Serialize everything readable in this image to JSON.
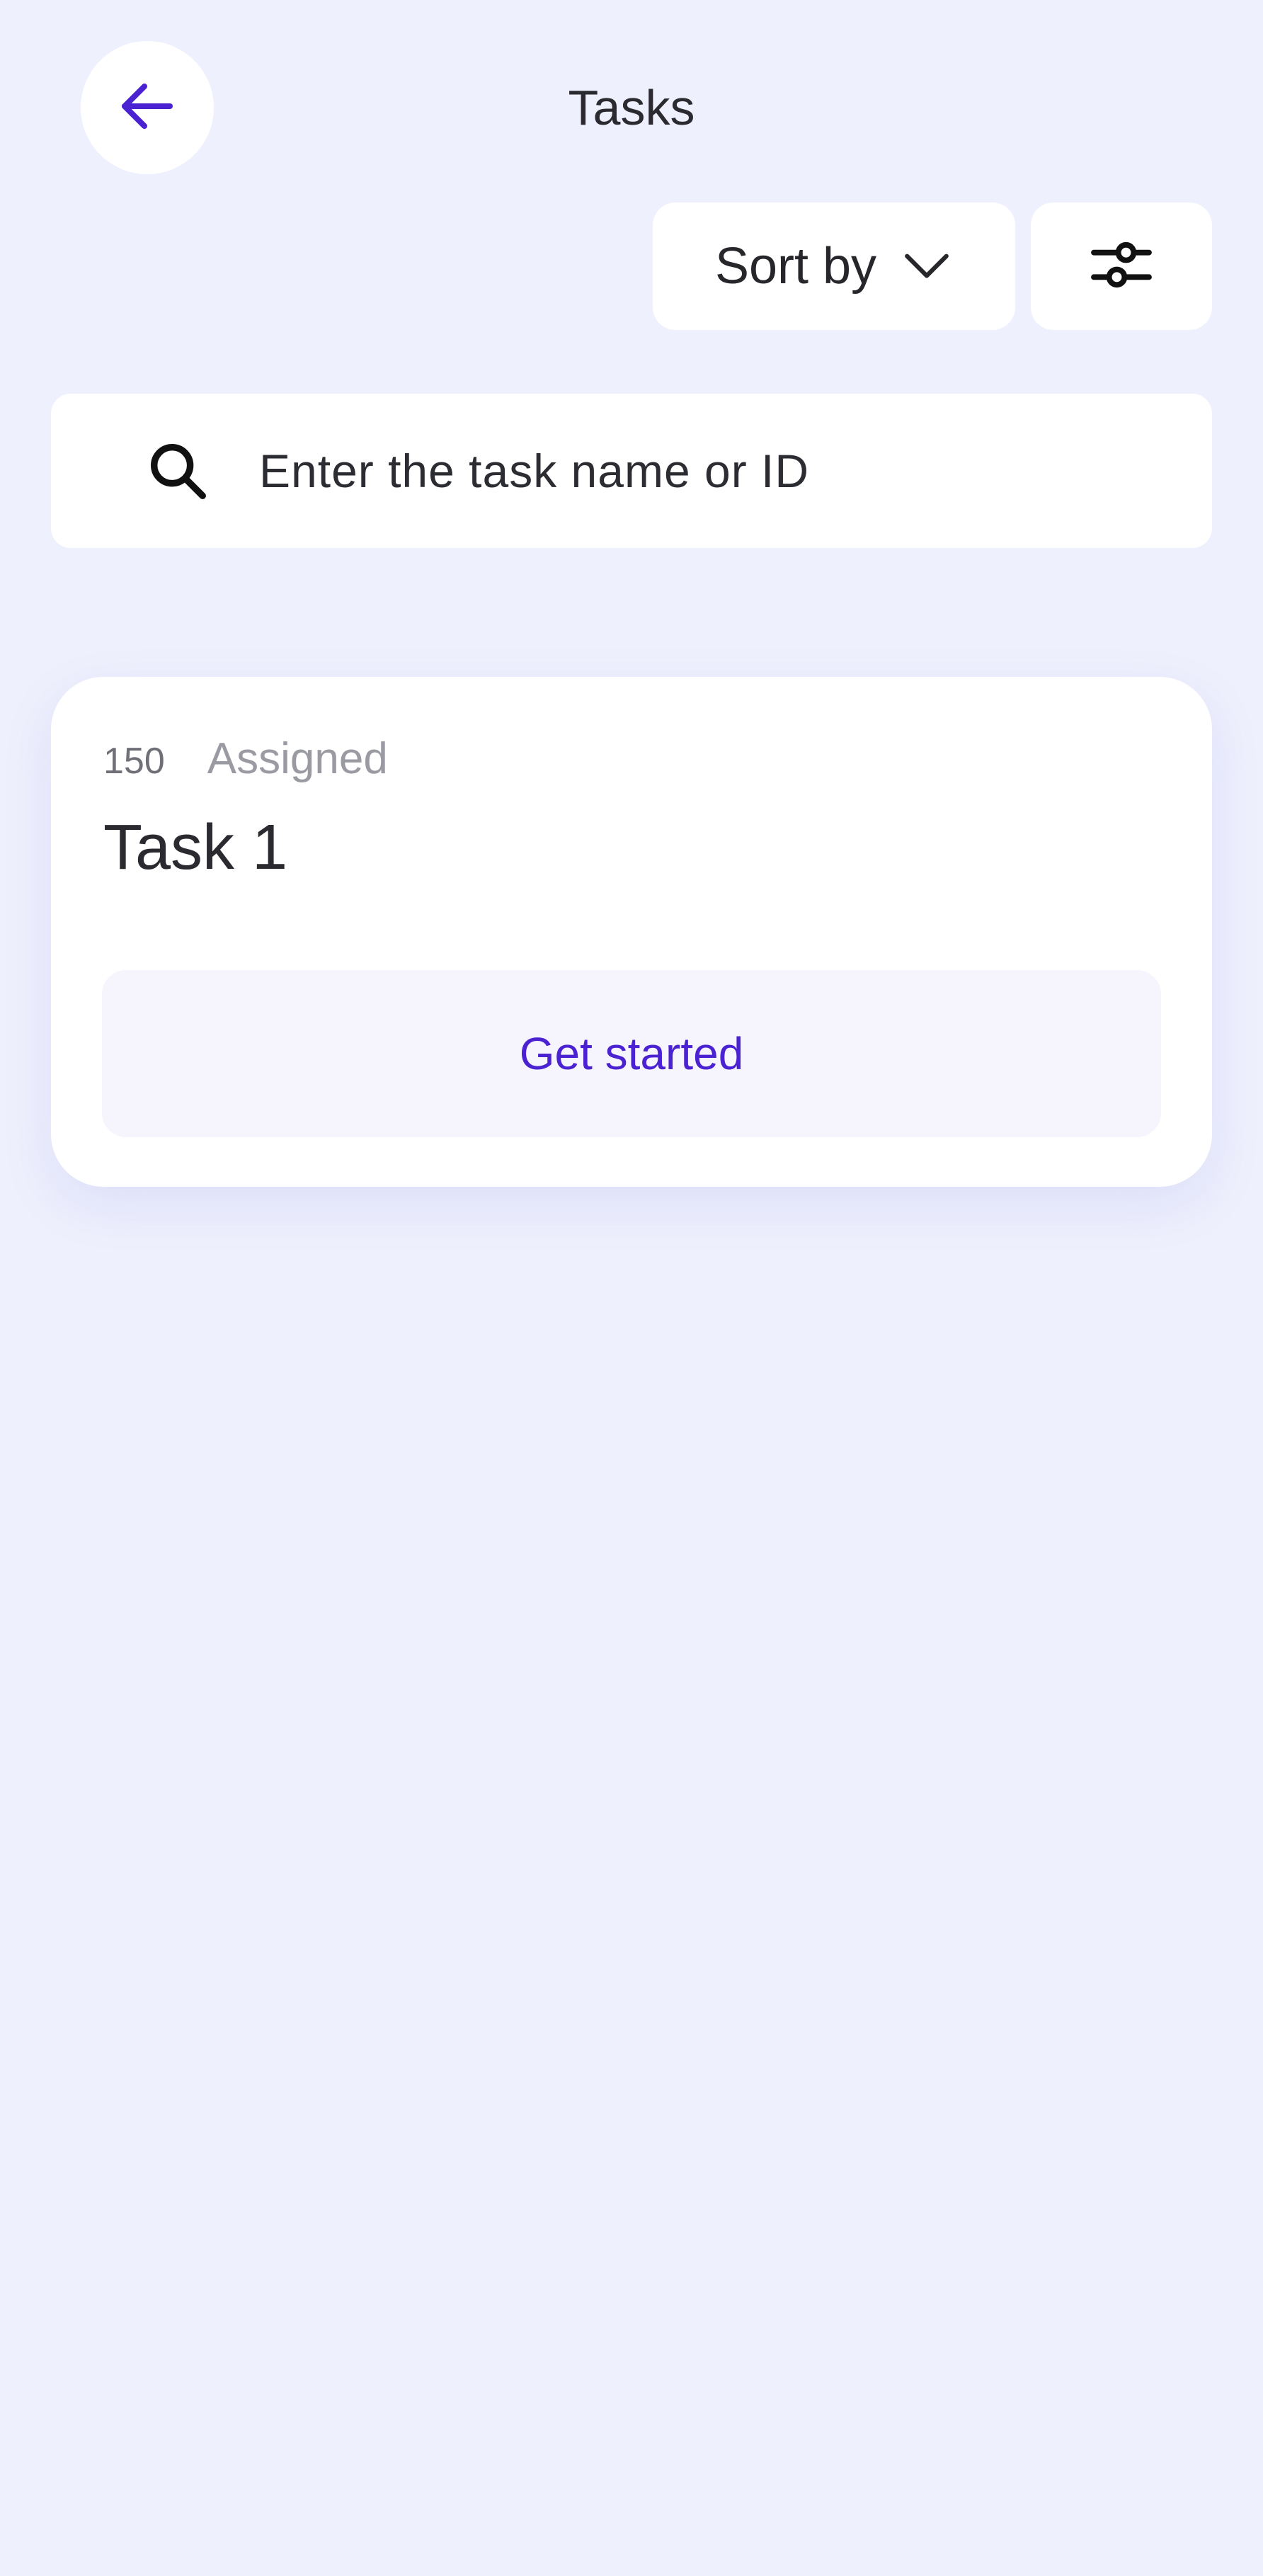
{
  "header": {
    "title": "Tasks",
    "back_icon": "arrow-left-icon"
  },
  "toolbar": {
    "sort_label": "Sort by",
    "sort_icon": "chevron-down-icon",
    "filter_icon": "sliders-icon"
  },
  "search": {
    "placeholder": "Enter the task name or ID",
    "value": "",
    "icon": "search-icon"
  },
  "tasks": [
    {
      "id": "150",
      "status": "Assigned",
      "name": "Task 1",
      "action_label": "Get started"
    }
  ],
  "colors": {
    "background": "#eef0fd",
    "accent": "#4b22d2",
    "card": "#ffffff",
    "button_soft": "#f6f4fd"
  }
}
